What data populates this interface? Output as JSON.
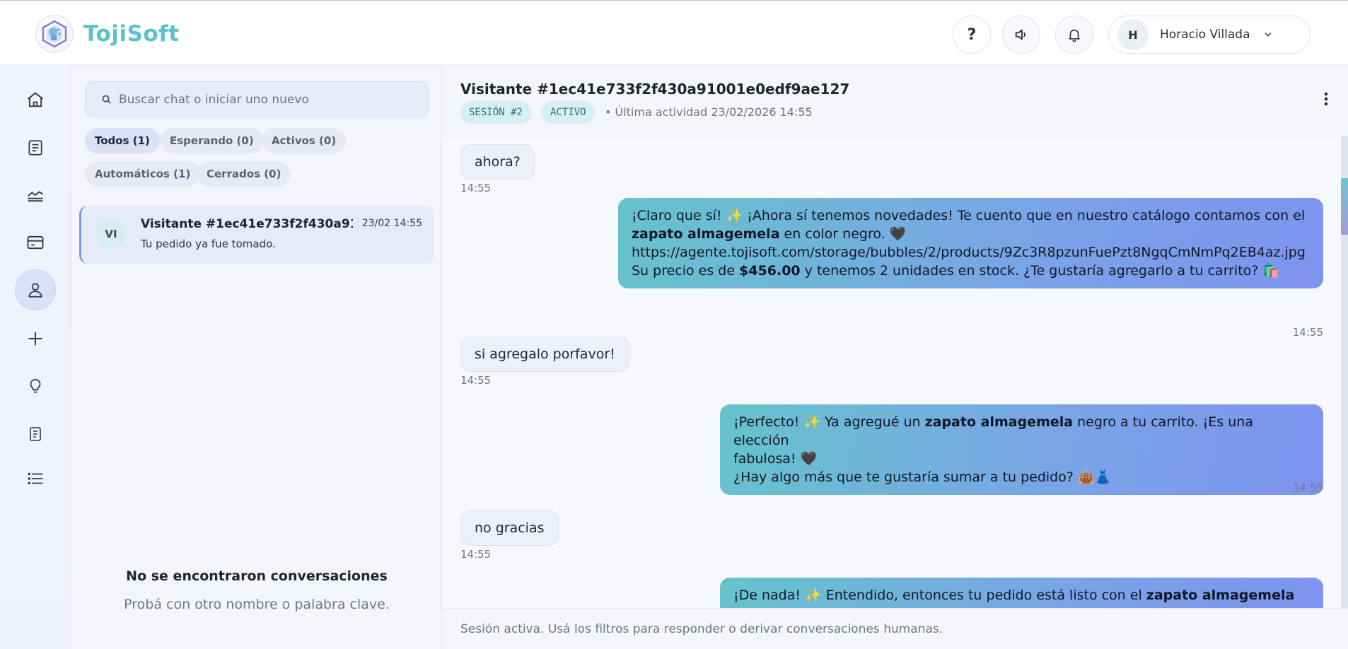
{
  "app": {
    "name": "TojiSoft"
  },
  "header": {
    "help_label": "?",
    "user": {
      "initial": "H",
      "name": "Horacio Villada"
    }
  },
  "rail": {
    "items": [
      {
        "icon": "home-icon"
      },
      {
        "icon": "document-icon"
      },
      {
        "icon": "chart-icon"
      },
      {
        "icon": "card-icon"
      },
      {
        "icon": "user-icon",
        "active": true
      },
      {
        "icon": "plus-icon"
      },
      {
        "icon": "lightbulb-icon"
      },
      {
        "icon": "notes-icon"
      },
      {
        "icon": "list-icon"
      }
    ]
  },
  "list": {
    "search_placeholder": "Buscar chat o iniciar uno nuevo",
    "filters": {
      "all": "Todos (1)",
      "waiting": "Esperando (0)",
      "active": "Activos (0)",
      "automatic": "Automáticos (1)",
      "closed": "Cerrados (0)"
    },
    "conversation": {
      "initials": "VI",
      "title": "Visitante #1ec41e733f2f430a91...",
      "date": "23/02 14:55",
      "preview": "Tu pedido ya fue tomado."
    },
    "empty_title": "No se encontraron conversaciones",
    "empty_subtitle": "Probá con otro nombre o palabra clave."
  },
  "chat": {
    "title": "Visitante #1ec41e733f2f430a91001e0edf9ae127",
    "session_tag": "SESIÓN #2",
    "status_tag": "ACTIVO",
    "last_activity": "• Última actividad 23/02/2026 14:55",
    "messages": {
      "m1": {
        "text": "ahora?",
        "time": "14:55"
      },
      "m2": {
        "l1": "¡Claro que sí! ✨ ¡Ahora sí tenemos novedades! Te cuento que en nuestro catálogo contamos con el",
        "l2_bold": "zapato almagemela",
        "l2_rest": " en color negro. 🖤",
        "l3": "https://agente.tojisoft.com/storage/bubbles/2/products/9Zc3R8pzunFuePzt8NgqCmNmPq2EB4az.jpg",
        "l4_pre": "Su precio es de ",
        "l4_bold": "$456.00",
        "l4_rest": " y tenemos 2 unidades en stock. ¿Te gustaría agregarlo a tu carrito? 🛍️",
        "time": "14:55"
      },
      "m3": {
        "text": "si agregalo porfavor!",
        "time": "14:55"
      },
      "m4": {
        "l1_pre": "¡Perfecto! ✨ Ya agregué un ",
        "l1_bold": "zapato almagemela",
        "l1_rest": " negro a tu carrito. ¡Es una elección",
        "l2": "fabulosa! 🖤",
        "l3": "¿Hay algo más que te gustaría sumar a tu pedido? 👜👗",
        "time": "14:55"
      },
      "m5": {
        "text": "no gracias",
        "time": "14:55"
      },
      "m6": {
        "l1_pre": "¡De nada! ✨ Entendido, entonces tu pedido está listo con el ",
        "l1_bold": "zapato almagemela"
      }
    },
    "footer": "Sesión activa. Usá los filtros para responder o derivar conversaciones humanas."
  },
  "colors": {
    "brand": "#5ec1c9",
    "accent": "#7e93f0",
    "outgoing_start": "#66c3cc",
    "outgoing_end": "#7e93f0"
  }
}
